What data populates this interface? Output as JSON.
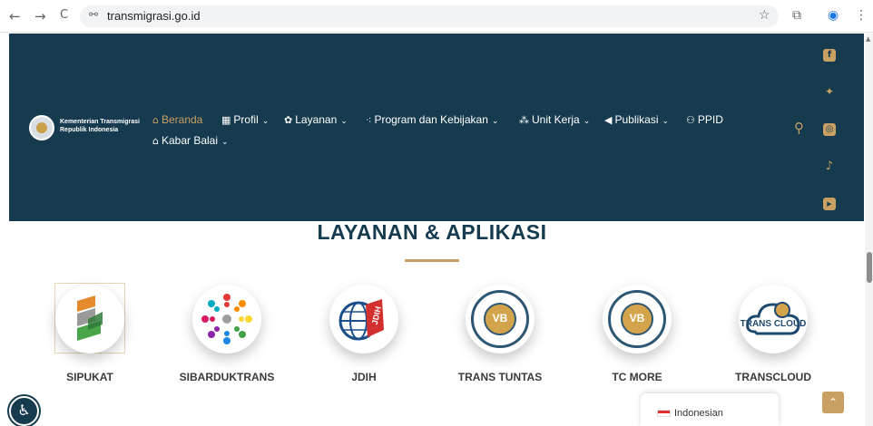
{
  "browser": {
    "back": "←",
    "forward": "→",
    "reload": "C",
    "url": "transmigrasi.go.id",
    "star": "☆",
    "extensions": "⧉",
    "profile": "◉",
    "menu": "⋮",
    "tune": "⚯"
  },
  "header": {
    "org_line1": "Kementerian Transmigrasi",
    "org_line2": "Republik Indonesia",
    "nav": [
      {
        "label": "Beranda",
        "icon": "home-icon",
        "glyph": "⌂",
        "dropdown": false
      },
      {
        "label": "Profil",
        "icon": "building-icon",
        "glyph": "▦",
        "dropdown": true
      },
      {
        "label": "Layanan",
        "icon": "gear-icon",
        "glyph": "✿",
        "dropdown": true
      },
      {
        "label": "Program dan Kebijakan",
        "icon": "nodes-icon",
        "glyph": "⁖",
        "dropdown": true
      },
      {
        "label": "Unit Kerja",
        "icon": "org-icon",
        "glyph": "⁂",
        "dropdown": true
      },
      {
        "label": "Publikasi",
        "icon": "megaphone-icon",
        "glyph": "◀",
        "dropdown": true
      },
      {
        "label": "PPID",
        "icon": "users-icon",
        "glyph": "⚇",
        "dropdown": false
      },
      {
        "label": "Kabar Balai",
        "icon": "news-icon",
        "glyph": "⌂",
        "dropdown": true
      }
    ],
    "search_glyph": "⚲",
    "social": [
      {
        "name": "facebook-icon",
        "glyph": "f"
      },
      {
        "name": "twitter-icon",
        "glyph": "✦"
      },
      {
        "name": "instagram-icon",
        "glyph": "◎"
      },
      {
        "name": "tiktok-icon",
        "glyph": "♪"
      },
      {
        "name": "youtube-icon",
        "glyph": "▶"
      }
    ],
    "chevron": "⌄"
  },
  "section": {
    "title": "LAYANAN & APLIKASI"
  },
  "apps": [
    {
      "label": "SIPUKAT"
    },
    {
      "label": "SIBARDUKTRANS"
    },
    {
      "label": "JDIH",
      "logo_text": "JDIH"
    },
    {
      "label": "TRANS TUNTAS",
      "logo_text": "VB"
    },
    {
      "label": "TC MORE",
      "logo_text": "VB"
    },
    {
      "label": "TRANSCLOUD",
      "logo_text": "TRANS CLOUD"
    }
  ],
  "footer": {
    "accessibility_glyph": "♿",
    "language": "Indonesian",
    "top_glyph": "⌃"
  },
  "colors": {
    "navy": "#163b4f",
    "gold": "#c9a063"
  }
}
